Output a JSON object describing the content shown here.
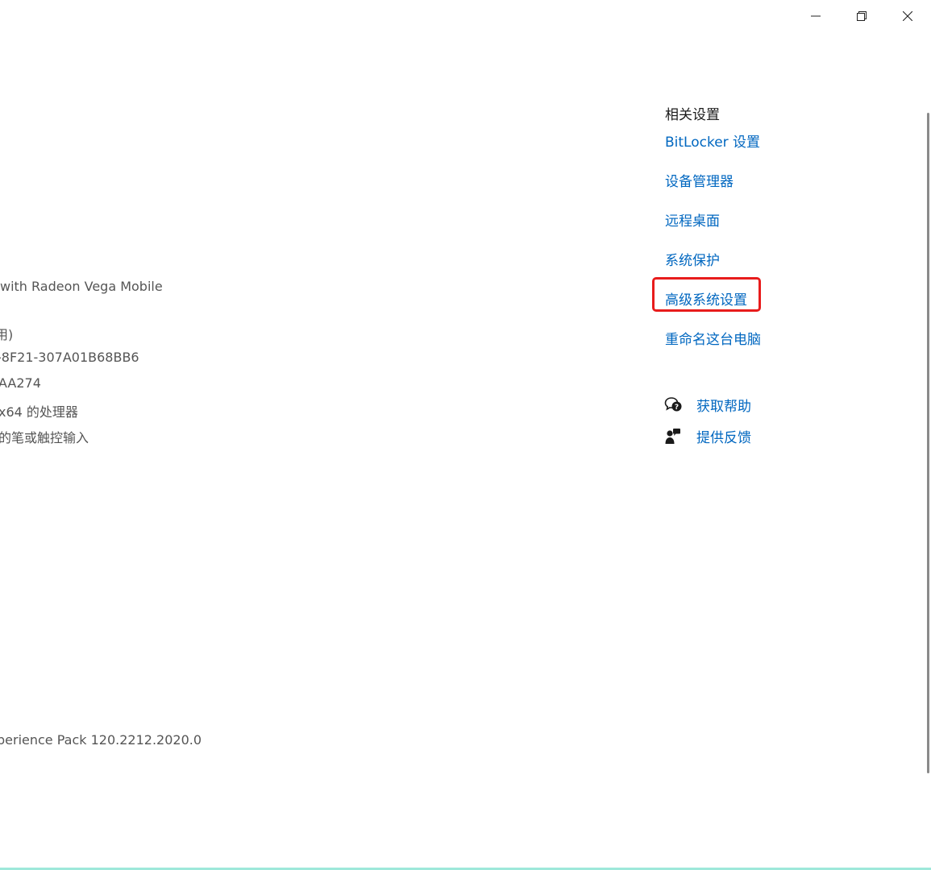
{
  "window": {
    "minimize_icon": "minimize-icon",
    "restore_icon": "restore-icon",
    "close_icon": "close-icon"
  },
  "specs": {
    "processor_suffix": "with Radeon Vega Mobile",
    "ram_suffix": "用)",
    "device_id_suffix": "-8F21-307A01B68BB6",
    "product_id_suffix": "AA274",
    "system_type_suffix": "x64 的处理器",
    "pen_touch_suffix": "的笔或触控输入",
    "experience_suffix": "perience Pack 120.2212.2020.0"
  },
  "related": {
    "title": "相关设置",
    "links": [
      {
        "label": "BitLocker 设置"
      },
      {
        "label": "设备管理器"
      },
      {
        "label": "远程桌面"
      },
      {
        "label": "系统保护"
      },
      {
        "label": "高级系统设置"
      },
      {
        "label": "重命名这台电脑"
      }
    ]
  },
  "help": {
    "get_help": "获取帮助",
    "get_help_icon": "chat-help-icon",
    "feedback": "提供反馈",
    "feedback_icon": "feedback-person-icon"
  },
  "colors": {
    "link": "#0067c0",
    "highlight": "#e81c1c"
  }
}
